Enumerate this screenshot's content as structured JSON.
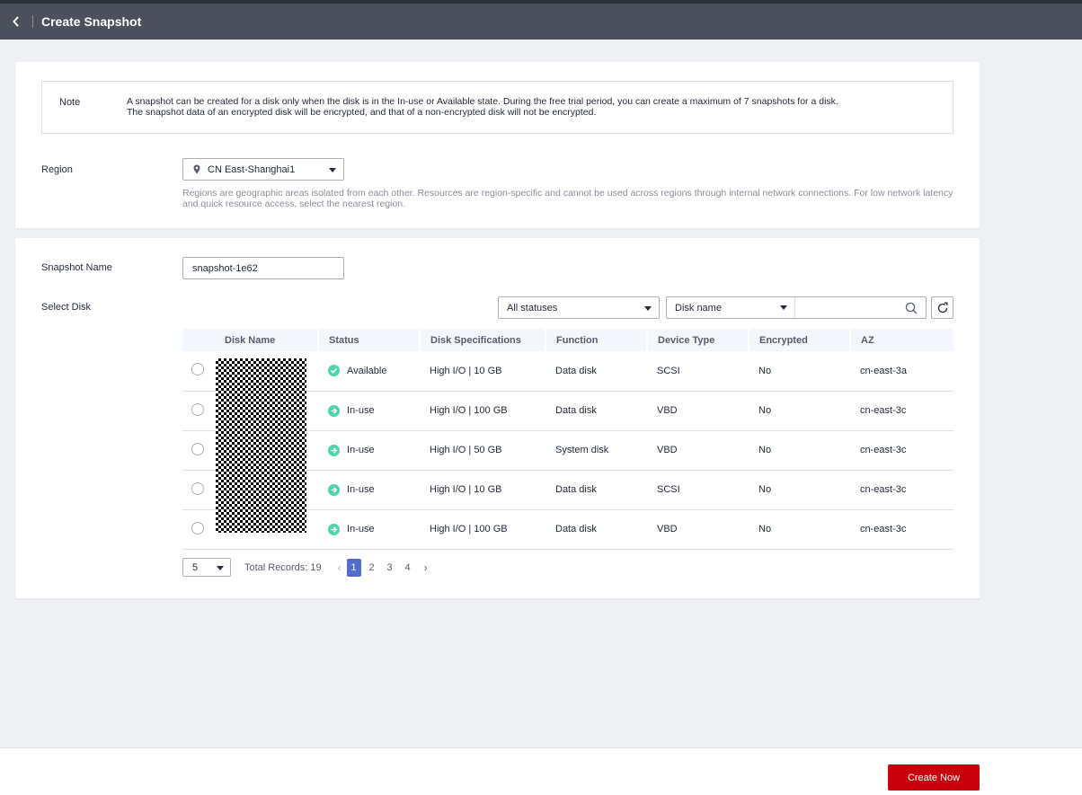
{
  "header": {
    "title": "Create Snapshot"
  },
  "note": {
    "label": "Note",
    "line1": "A snapshot can be created for a disk only when the disk is in the In-use or Available state. During the free trial period, you can create a maximum of 7 snapshots for a disk.",
    "line2": "The snapshot data of an encrypted disk will be encrypted, and that of a non-encrypted disk will not be encrypted."
  },
  "region": {
    "label": "Region",
    "value": "CN East-Shanghai1",
    "help": "Regions are geographic areas isolated from each other. Resources are region-specific and cannot be used across regions through internal network connections. For low network latency and quick resource access, select the nearest region."
  },
  "snapshot": {
    "label": "Snapshot Name",
    "value": "snapshot-1e62"
  },
  "disk": {
    "label": "Select Disk",
    "status_filter": "All statuses",
    "search_field": "Disk name",
    "search_value": ""
  },
  "table": {
    "columns": [
      "Disk Name",
      "Status",
      "Disk Specifications",
      "Function",
      "Device Type",
      "Encrypted",
      "AZ"
    ],
    "rows": [
      {
        "status": "Available",
        "spec": "High I/O | 10 GB",
        "function": "Data disk",
        "device": "SCSI",
        "encrypted": "No",
        "az": "cn-east-3a"
      },
      {
        "status": "In-use",
        "spec": "High I/O | 100 GB",
        "function": "Data disk",
        "device": "VBD",
        "encrypted": "No",
        "az": "cn-east-3c"
      },
      {
        "status": "In-use",
        "spec": "High I/O | 50 GB",
        "function": "System disk",
        "device": "VBD",
        "encrypted": "No",
        "az": "cn-east-3c"
      },
      {
        "status": "In-use",
        "spec": "High I/O | 10 GB",
        "function": "Data disk",
        "device": "SCSI",
        "encrypted": "No",
        "az": "cn-east-3c"
      },
      {
        "status": "In-use",
        "spec": "High I/O | 100 GB",
        "function": "Data disk",
        "device": "VBD",
        "encrypted": "No",
        "az": "cn-east-3c"
      }
    ]
  },
  "pagination": {
    "page_size": "5",
    "total": "Total Records: 19",
    "pages": [
      "1",
      "2",
      "3",
      "4"
    ],
    "current": "1"
  },
  "footer": {
    "create_label": "Create Now"
  },
  "colors": {
    "brand_red": "#c7000b",
    "status_green": "#50d4ab",
    "active_page": "#526ecc"
  }
}
